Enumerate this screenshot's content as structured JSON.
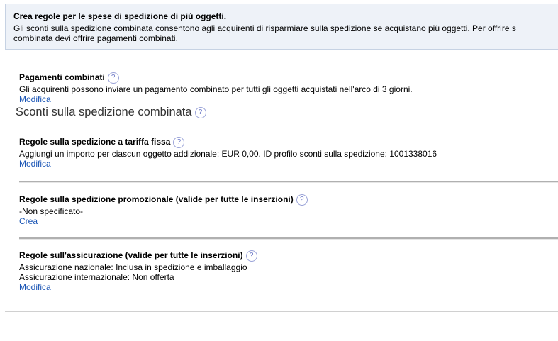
{
  "banner": {
    "title": "Crea regole per le spese di spedizione di più oggetti.",
    "line1": "Gli sconti sulla spedizione combinata consentono agli acquirenti di risparmiare sulla spedizione se acquistano più oggetti. Per offrire s",
    "line2": "combinata devi offrire pagamenti combinati."
  },
  "combined_payments": {
    "title": "Pagamenti combinati",
    "description": "Gli acquirenti possono inviare un pagamento combinato per tutti gli oggetti acquistati nell'arco di 3 giorni.",
    "link": "Modifica"
  },
  "combined_discounts_heading": "Sconti sulla spedizione combinata",
  "flat_rate": {
    "title": "Regole sulla spedizione a tariffa fissa",
    "description": "Aggiungi un importo per ciascun oggetto addizionale: EUR 0,00. ID profilo sconti sulla spedizione: 1001338016",
    "link": "Modifica"
  },
  "promotional": {
    "title": "Regole sulla spedizione promozionale (valide per tutte le inserzioni)",
    "description": "-Non specificato-",
    "link": "Crea"
  },
  "insurance": {
    "title": "Regole sull'assicurazione (valide per tutte le inserzioni)",
    "domestic": "Assicurazione nazionale: Inclusa in spedizione e imballaggio",
    "international": "Assicurazione internazionale: Non offerta",
    "link": "Modifica"
  },
  "help_glyph": "?"
}
